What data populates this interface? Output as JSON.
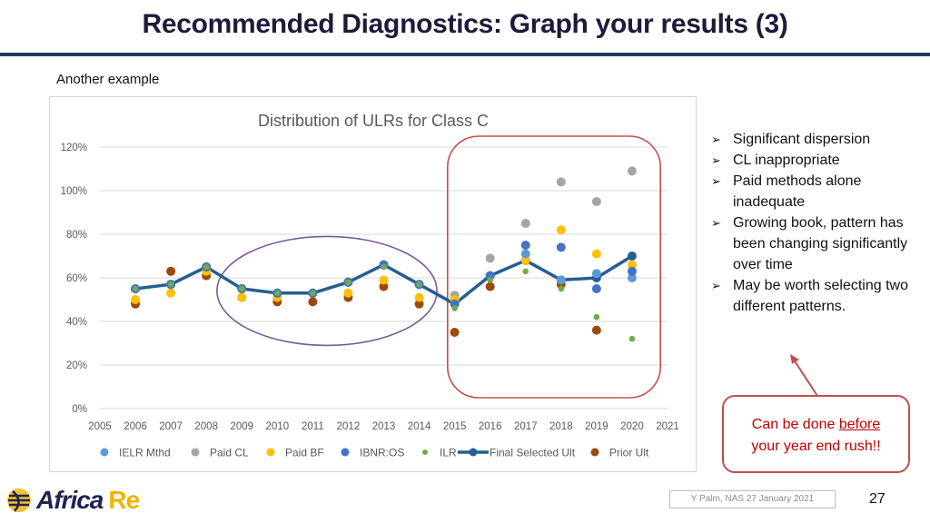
{
  "slide": {
    "title": "Recommended Diagnostics: Graph your results (3)",
    "subtitle": "Another example",
    "bullets": [
      "Significant dispersion",
      "CL inappropriate",
      "Paid methods alone inadequate",
      "Growing book, pattern has been changing significantly over time",
      "May be worth selecting two different patterns."
    ],
    "bullet_icon": "arrowhead-bullet-icon",
    "callout": {
      "pre": "Can be done ",
      "emphasis": "before",
      "post": " your year end rush!!"
    },
    "footer": "Y Palm, NAS 27 January 2021",
    "page_number": "27",
    "logo": {
      "part1": "Africa",
      "part2": "Re"
    }
  },
  "colors": {
    "title": "#1d1b3a",
    "rule": "#213a5c",
    "callout": "#c0504d",
    "callout_text": "#c00000",
    "highlight_ellipse": "#7a5a9e",
    "highlight_box": "#c0504d"
  },
  "chart_data": {
    "type": "scatter",
    "title": "Distribution of ULRs for Class C",
    "xlabel": "",
    "ylabel": "",
    "x": [
      2005,
      2006,
      2007,
      2008,
      2009,
      2010,
      2011,
      2012,
      2013,
      2014,
      2015,
      2016,
      2017,
      2018,
      2019,
      2020,
      2021
    ],
    "xlim": [
      2005,
      2021
    ],
    "ylim": [
      0,
      120
    ],
    "yticks": [
      0,
      20,
      40,
      60,
      80,
      100,
      120
    ],
    "ytick_labels": [
      "0%",
      "20%",
      "40%",
      "60%",
      "80%",
      "100%",
      "120%"
    ],
    "grid": true,
    "legend_position": "bottom",
    "series": [
      {
        "name": "IELR Mthd",
        "kind": "marker",
        "color": "#5b9bd5",
        "points": [
          [
            2006,
            55
          ],
          [
            2007,
            57
          ],
          [
            2008,
            65
          ],
          [
            2009,
            55
          ],
          [
            2010,
            53
          ],
          [
            2011,
            53
          ],
          [
            2012,
            58
          ],
          [
            2013,
            66
          ],
          [
            2014,
            57
          ],
          [
            2015,
            48
          ],
          [
            2016,
            61
          ],
          [
            2017,
            71
          ],
          [
            2018,
            59
          ],
          [
            2019,
            62
          ],
          [
            2020,
            60
          ]
        ]
      },
      {
        "name": "Paid CL",
        "kind": "marker",
        "color": "#a5a5a5",
        "points": [
          [
            2015,
            52
          ],
          [
            2016,
            69
          ],
          [
            2017,
            85
          ],
          [
            2018,
            104
          ],
          [
            2019,
            95
          ],
          [
            2020,
            109
          ]
        ]
      },
      {
        "name": "Paid BF",
        "kind": "marker",
        "color": "#ffc000",
        "points": [
          [
            2006,
            50
          ],
          [
            2007,
            53
          ],
          [
            2008,
            63
          ],
          [
            2009,
            51
          ],
          [
            2010,
            51
          ],
          [
            2011,
            null
          ],
          [
            2012,
            53
          ],
          [
            2013,
            59
          ],
          [
            2014,
            51
          ],
          [
            2015,
            50
          ],
          [
            2017,
            68
          ],
          [
            2018,
            82
          ],
          [
            2019,
            71
          ],
          [
            2020,
            66
          ]
        ]
      },
      {
        "name": "IBNR:OS",
        "kind": "marker",
        "color": "#4472c4",
        "points": [
          [
            2006,
            55
          ],
          [
            2007,
            57
          ],
          [
            2008,
            65
          ],
          [
            2009,
            55
          ],
          [
            2010,
            53
          ],
          [
            2011,
            53
          ],
          [
            2012,
            58
          ],
          [
            2013,
            66
          ],
          [
            2014,
            57
          ],
          [
            2015,
            48
          ],
          [
            2016,
            61
          ],
          [
            2017,
            75
          ],
          [
            2018,
            74
          ],
          [
            2019,
            55
          ],
          [
            2020,
            63
          ]
        ]
      },
      {
        "name": "ILR",
        "kind": "small-marker",
        "color": "#70ad47",
        "points": [
          [
            2006,
            55
          ],
          [
            2007,
            57
          ],
          [
            2008,
            65
          ],
          [
            2009,
            55
          ],
          [
            2010,
            53
          ],
          [
            2011,
            53
          ],
          [
            2012,
            58
          ],
          [
            2013,
            65
          ],
          [
            2014,
            57
          ],
          [
            2015,
            46
          ],
          [
            2016,
            59
          ],
          [
            2017,
            63
          ],
          [
            2018,
            55
          ],
          [
            2019,
            42
          ],
          [
            2020,
            32
          ]
        ]
      },
      {
        "name": "Final Selected Ult",
        "kind": "line",
        "color": "#255e91",
        "points": [
          [
            2006,
            55
          ],
          [
            2007,
            57
          ],
          [
            2008,
            65
          ],
          [
            2009,
            55
          ],
          [
            2010,
            53
          ],
          [
            2011,
            53
          ],
          [
            2012,
            58
          ],
          [
            2013,
            66
          ],
          [
            2014,
            57
          ],
          [
            2015,
            48
          ],
          [
            2016,
            61
          ],
          [
            2017,
            68
          ],
          [
            2018,
            59
          ],
          [
            2019,
            60
          ],
          [
            2020,
            70
          ]
        ]
      },
      {
        "name": "Prior Ult",
        "kind": "marker",
        "color": "#9e480e",
        "points": [
          [
            2006,
            48
          ],
          [
            2007,
            63
          ],
          [
            2008,
            61
          ],
          [
            2009,
            51
          ],
          [
            2010,
            49
          ],
          [
            2011,
            49
          ],
          [
            2012,
            51
          ],
          [
            2013,
            56
          ],
          [
            2014,
            48
          ],
          [
            2015,
            35
          ],
          [
            2016,
            56
          ],
          [
            2017,
            68
          ],
          [
            2018,
            57
          ],
          [
            2019,
            36
          ]
        ]
      }
    ],
    "annotations": [
      {
        "type": "ellipse",
        "label": "stable-period-highlight",
        "x_range": [
          2008.3,
          2014.5
        ],
        "y_range": [
          29,
          79
        ]
      },
      {
        "type": "rounded-rect",
        "label": "recent-period-highlight",
        "x_range": [
          2014.8,
          2020.8
        ],
        "y_range": [
          5,
          125
        ]
      }
    ]
  }
}
